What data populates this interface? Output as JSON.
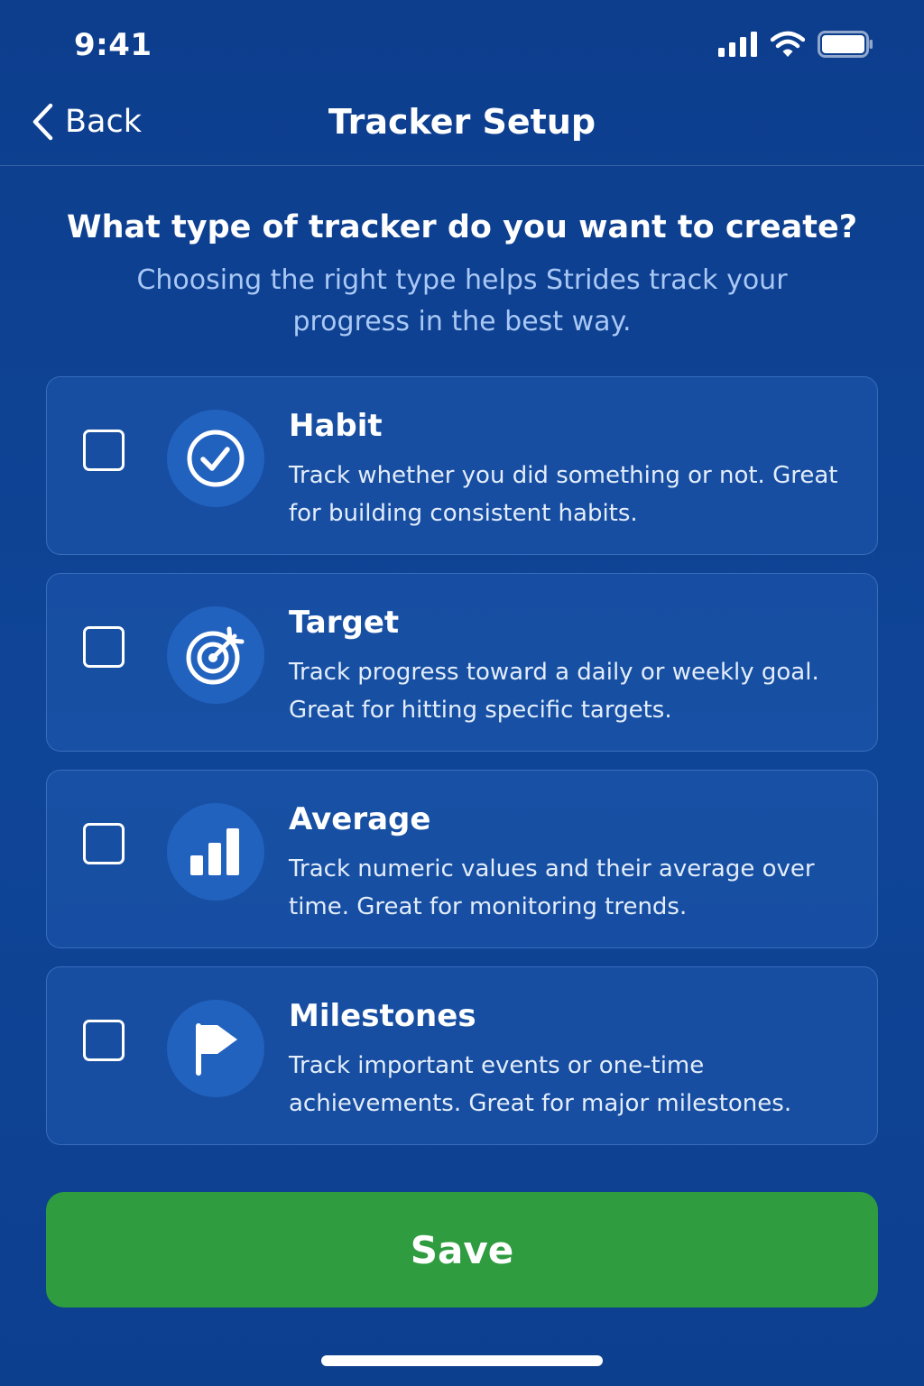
{
  "status_bar": {
    "time": "9:41",
    "icons": [
      "cellular-signal-icon",
      "wifi-icon",
      "battery-icon"
    ]
  },
  "nav": {
    "back_label": "Back",
    "back_icon": "chevron-left-icon",
    "title": "Tracker Setup"
  },
  "header": {
    "question": "What type of tracker do you want to create?",
    "subtitle": "Choosing the right type helps Strides track your progress in the best way."
  },
  "tracker_types": [
    {
      "title": "Habit",
      "description": "Track whether you did something or not. Great for building consistent habits.",
      "icon": "check-circle-icon",
      "checked": false
    },
    {
      "title": "Target",
      "description": "Track progress toward a daily or weekly goal. Great for hitting specific targets.",
      "icon": "target-icon",
      "checked": false
    },
    {
      "title": "Average",
      "description": "Track numeric values and their average over time. Great for monitoring trends.",
      "icon": "bar-chart-icon",
      "checked": false
    },
    {
      "title": "Milestones",
      "description": "Track important events or one-time achievements. Great for major milestones.",
      "icon": "flag-icon",
      "checked": false
    }
  ],
  "save_label": "Save",
  "colors": {
    "background": "#0d3f8f",
    "card": "#1a4f9c",
    "icon_circle": "#2262bf",
    "subtitle_text": "#a9c8f5",
    "save_button": "#2f9c40"
  }
}
